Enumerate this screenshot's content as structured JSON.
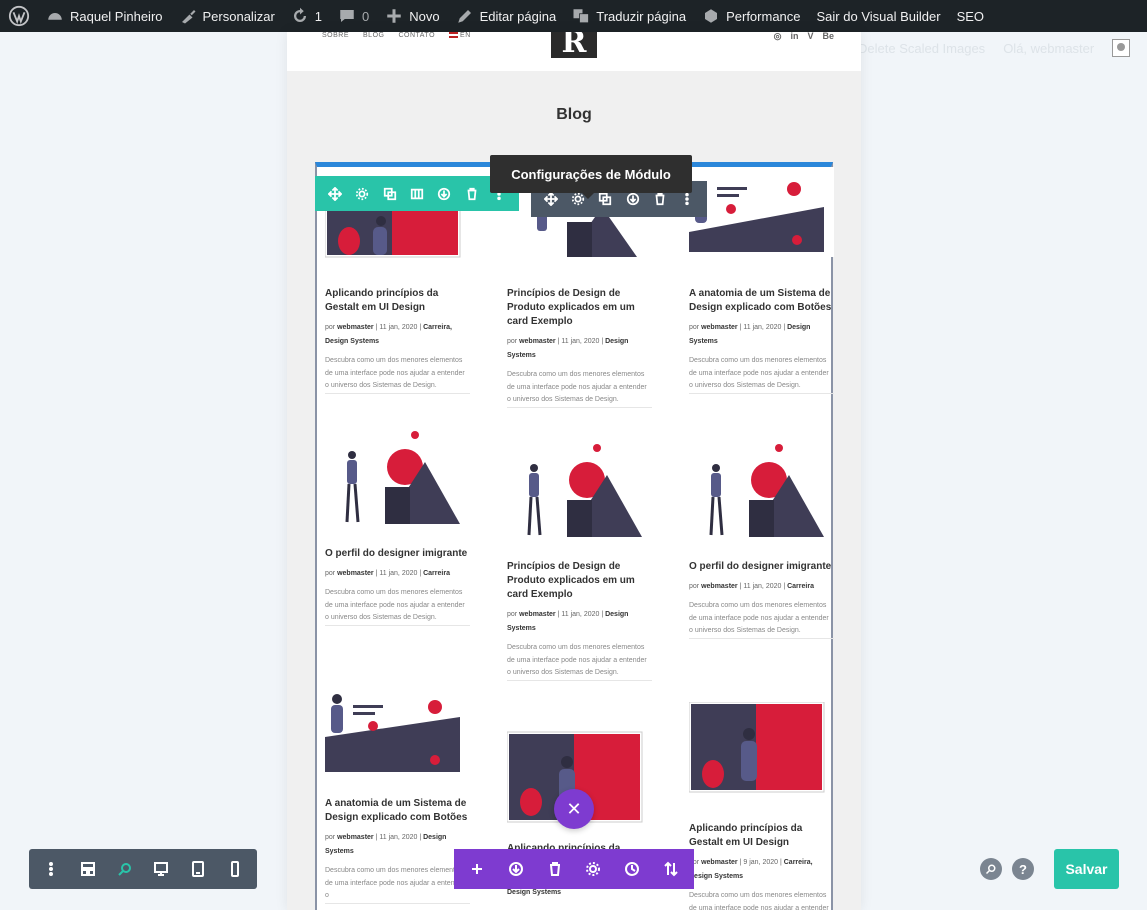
{
  "adminbar": {
    "site_name": "Raquel Pinheiro",
    "customize": "Personalizar",
    "updates_count": "1",
    "comments_count": "0",
    "new": "Novo",
    "edit_page": "Editar página",
    "translate_page": "Traduzir página",
    "performance": "Performance",
    "exit_builder": "Sair do Visual Builder",
    "seo": "SEO"
  },
  "ghost": {
    "left": "Delete Scaled Images",
    "right": "Olá, webmaster"
  },
  "site": {
    "nav": [
      "SOBRE",
      "BLOG",
      "CONTATO",
      "EN"
    ],
    "logo": "R",
    "social": [
      "◎",
      "in",
      "V",
      "Be"
    ]
  },
  "page_title": "Blog",
  "tooltip": "Configurações de Módulo",
  "posts": {
    "col1": [
      {
        "title": "Aplicando princípios da Gestalt em UI Design",
        "by": "por",
        "author": "webmaster",
        "date": "11 jan, 2020",
        "cats": "Carreira, Design Systems",
        "excerpt": "Descubra como um dos menores elementos de uma interface pode nos ajudar a entender o universo dos Sistemas de Design."
      },
      {
        "title": "O perfil do designer imigrante",
        "by": "por",
        "author": "webmaster",
        "date": "11 jan, 2020",
        "cats": "Carreira",
        "excerpt": "Descubra como um dos menores elementos de uma interface pode nos ajudar a entender o universo dos Sistemas de Design."
      },
      {
        "title": "A anatomia de um Sistema de Design explicado com Botões",
        "by": "por",
        "author": "webmaster",
        "date": "11 jan, 2020",
        "cats": "Design Systems",
        "excerpt": "Descubra como um dos menores elementos de uma interface pode nos ajudar a entender o"
      }
    ],
    "col2": [
      {
        "title": "Princípios de Design de Produto explicados em um card Exemplo",
        "by": "por",
        "author": "webmaster",
        "date": "11 jan, 2020",
        "cats": "Design Systems",
        "excerpt": "Descubra como um dos menores elementos de uma interface pode nos ajudar a entender o universo dos Sistemas de Design."
      },
      {
        "title": "Princípios de Design de Produto explicados em um card Exemplo",
        "by": "por",
        "author": "webmaster",
        "date": "11 jan, 2020",
        "cats": "Design Systems",
        "excerpt": "Descubra como um dos menores elementos de uma interface pode nos ajudar a entender o universo dos Sistemas de Design."
      },
      {
        "title": "Aplicando princípios da",
        "by": "",
        "author": "",
        "date": "",
        "cats": "Design Systems",
        "excerpt": ""
      }
    ],
    "col3": [
      {
        "title": "A anatomia de um Sistema de Design explicado com Botões",
        "by": "por",
        "author": "webmaster",
        "date": "11 jan, 2020",
        "cats": "Design Systems",
        "excerpt": "Descubra como um dos menores elementos de uma interface pode nos ajudar a entender o universo dos Sistemas de Design."
      },
      {
        "title": "O perfil do designer imigrante",
        "by": "por",
        "author": "webmaster",
        "date": "11 jan, 2020",
        "cats": "Carreira",
        "excerpt": "Descubra como um dos menores elementos de uma interface pode nos ajudar a entender o universo dos Sistemas de Design."
      },
      {
        "title": "Aplicando princípios da Gestalt em UI Design",
        "by": "por",
        "author": "webmaster",
        "date": "9 jan, 2020",
        "cats": "Carreira, Design Systems",
        "excerpt": "Descubra como um dos menores elementos de uma interface pode nos ajudar a entender o"
      }
    ]
  },
  "builder": {
    "save": "Salvar",
    "help": "?",
    "close": "✕"
  },
  "colors": {
    "admin_bar": "#1d2327",
    "module_toolbar": "#29c4a9",
    "section_toolbar": "#7e3bd0",
    "row_toolbar": "#4c5866",
    "accent_red": "#d71d3a",
    "dark_shape": "#3f3d56"
  }
}
